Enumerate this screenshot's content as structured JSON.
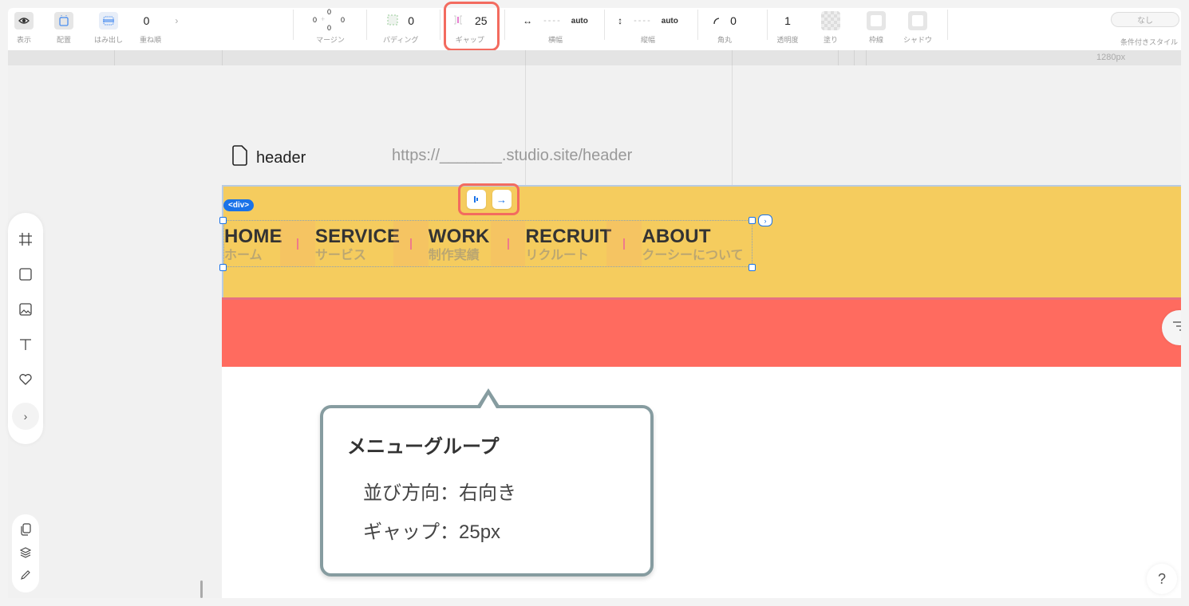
{
  "toolbar": {
    "display_label": "表示",
    "position_label": "配置",
    "overflow_label": "はみ出し",
    "zindex": {
      "value": "0",
      "label": "重ね順"
    },
    "margin": {
      "top": "0",
      "left": "0",
      "right": "0",
      "bottom": "0",
      "label": "マージン"
    },
    "padding": {
      "value": "0",
      "label": "パディング"
    },
    "gap": {
      "value": "25",
      "label": "ギャップ"
    },
    "width": {
      "value": "----",
      "unit": "auto",
      "label": "横幅"
    },
    "height": {
      "value": "----",
      "unit": "auto",
      "label": "縦幅"
    },
    "radius": {
      "value": "0",
      "label": "角丸"
    },
    "opacity": {
      "value": "1",
      "label": "透明度"
    },
    "fill_label": "塗り",
    "border_label": "枠線",
    "shadow_label": "シャドウ",
    "conditional": {
      "value": "なし",
      "label": "条件付きスタイル"
    }
  },
  "ruler": {
    "width_label": "1280px"
  },
  "page": {
    "name": "header",
    "url": "https://_______.studio.site/header"
  },
  "canvas": {
    "element_badge": "<div>",
    "colors": {
      "header_bg": "#f5cc5e",
      "band_bg": "#ff6b5f",
      "highlight": "#f36b5f"
    },
    "menu": [
      {
        "en": "HOME",
        "jp": "ホーム"
      },
      {
        "en": "SERVICE",
        "jp": "サービス"
      },
      {
        "en": "WORK",
        "jp": "制作実績"
      },
      {
        "en": "RECRUIT",
        "jp": "リクルート"
      },
      {
        "en": "ABOUT",
        "jp": "クーシーについて"
      }
    ]
  },
  "callout": {
    "title": "メニューグループ",
    "lines": [
      "並び方向：右向き",
      "ギャップ：25px"
    ]
  },
  "help": {
    "label": "?"
  }
}
